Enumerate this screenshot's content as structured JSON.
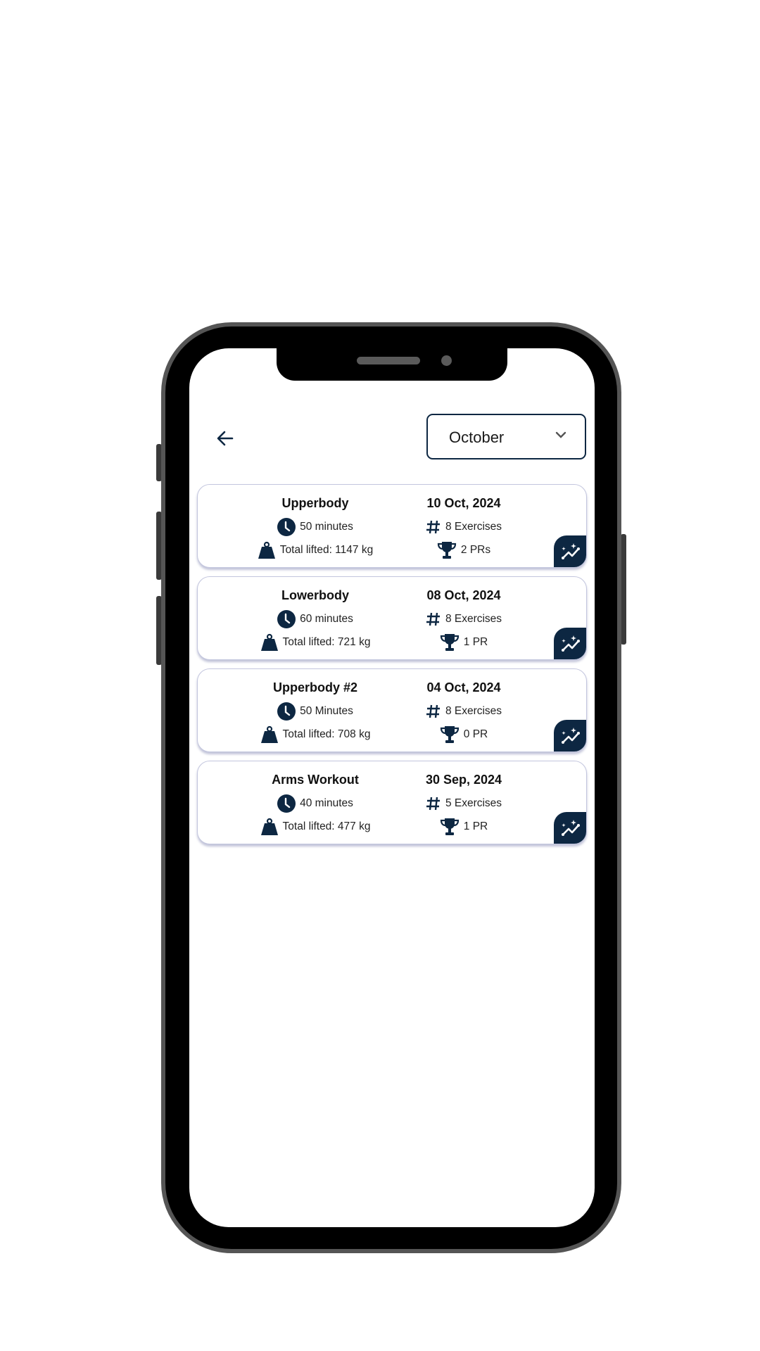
{
  "colors": {
    "accent": "#0d2742",
    "card_border": "#c3c6de"
  },
  "header": {
    "back_icon": "arrow-left-icon",
    "month_select": {
      "selected": "October",
      "icon": "chevron-down-icon"
    }
  },
  "workouts": [
    {
      "name": "Upperbody",
      "date": "10 Oct, 2024",
      "duration": "50 minutes",
      "exercises": "8 Exercises",
      "total": "Total lifted: 1147 kg",
      "prs": "2 PRs"
    },
    {
      "name": "Lowerbody",
      "date": "08 Oct, 2024",
      "duration": "60 minutes",
      "exercises": "8 Exercises",
      "total": "Total lifted: 721 kg",
      "prs": "1 PR"
    },
    {
      "name": "Upperbody #2",
      "date": "04 Oct, 2024",
      "duration": "50 Minutes",
      "exercises": "8 Exercises",
      "total": "Total lifted: 708 kg",
      "prs": "0 PR"
    },
    {
      "name": "Arms Workout",
      "date": "30 Sep, 2024",
      "duration": "40 minutes",
      "exercises": "5 Exercises",
      "total": "Total lifted: 477 kg",
      "prs": "1 PR"
    }
  ]
}
